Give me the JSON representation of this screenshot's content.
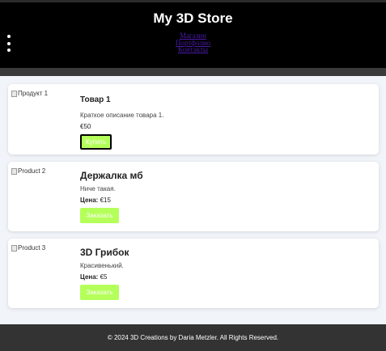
{
  "header": {
    "title": "My 3D Store",
    "nav": [
      "Магазин",
      "Портфолио",
      "Контакты"
    ]
  },
  "products": [
    {
      "img_alt": "Продукт 1",
      "title": "Товар 1",
      "description": "Краткое описание товара 1.",
      "price_label": "",
      "price": "€50",
      "button": "Купить"
    },
    {
      "img_alt": "Product 2",
      "title": "Держалка мб",
      "description": "Ниче такая.",
      "price_label": "Цена:",
      "price": "€15",
      "button": "Заказать"
    },
    {
      "img_alt": "Product 3",
      "title": "3D Грибок",
      "description": "Красивенький.",
      "price_label": "Цена:",
      "price": "€5",
      "button": "Заказать"
    }
  ],
  "footer": {
    "text": "© 2024 3D Creations by Daria Metzler. All Rights Reserved."
  },
  "colors": {
    "header_bg": "#000000",
    "button_bg": "#b4ff5a",
    "footer_bg": "#333333",
    "page_bg": "#f1f4f9"
  }
}
